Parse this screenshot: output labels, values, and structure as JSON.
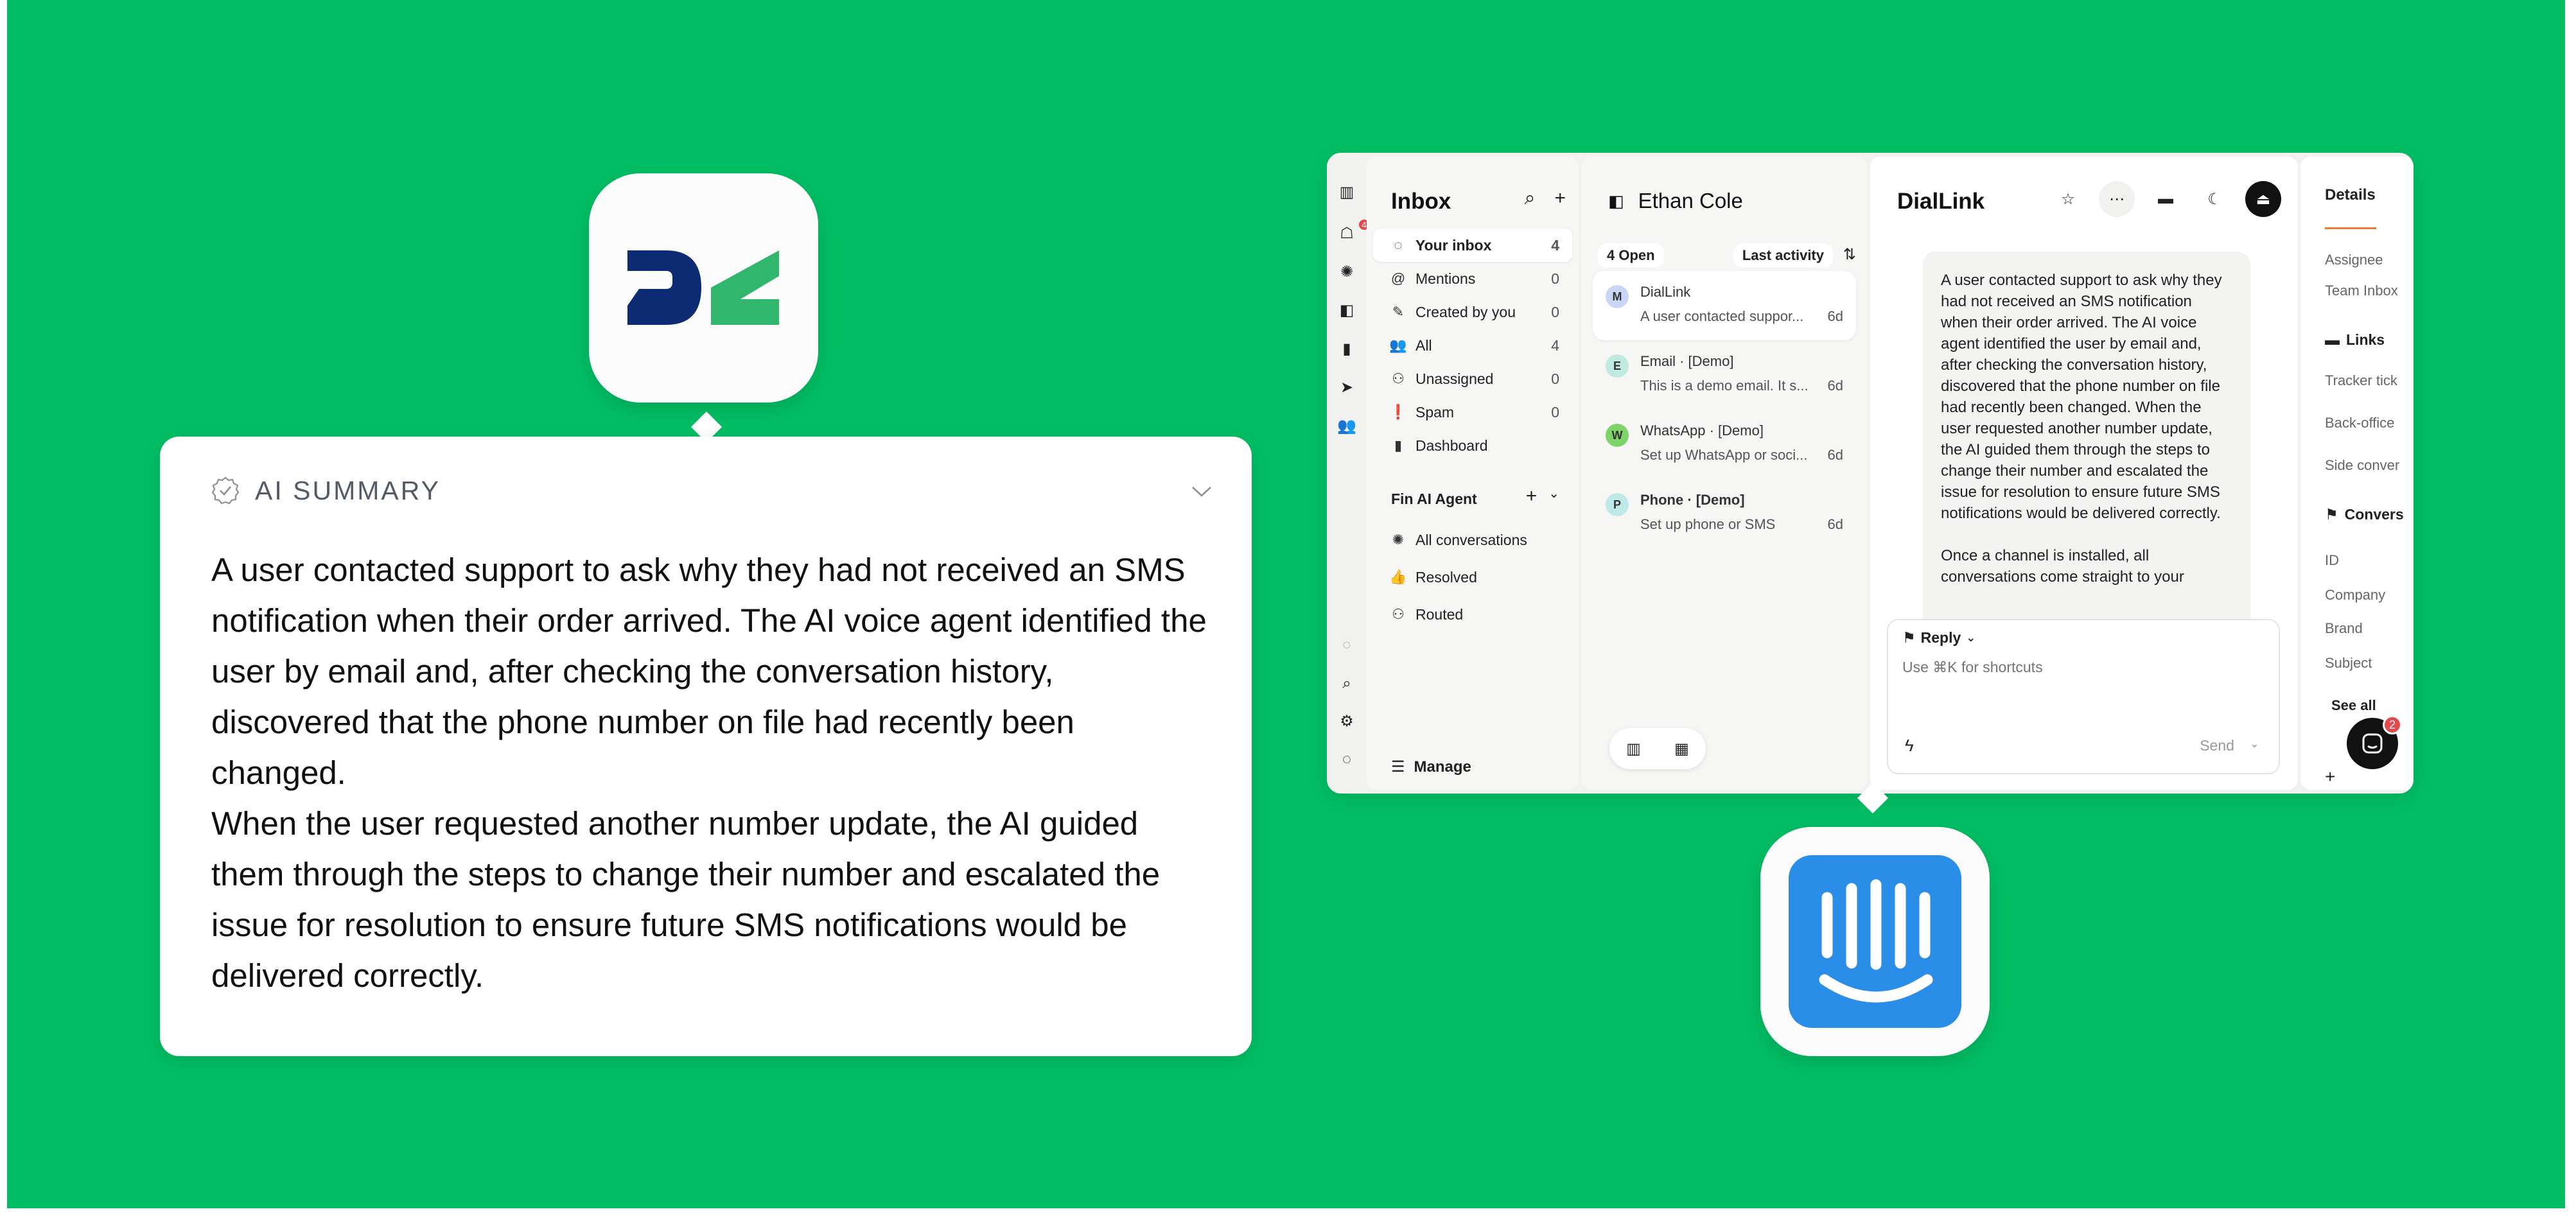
{
  "colors": {
    "background": "#02bd63",
    "intercom_blue": "#2a8de7",
    "dl_navy": "#0c2b73",
    "dl_green": "#31b66e"
  },
  "summary": {
    "icon": "check-badge-icon",
    "title": "AI SUMMARY",
    "paragraph1": "A user contacted support to ask why they had not received an SMS notification when their order arrived. The AI voice agent identified the user by email and, after checking the conversation history, discovered that the phone number on file had recently been changed.",
    "paragraph2": "When the user requested another number update, the AI guided them through the steps to change their number and escalated the issue for resolution to ensure future SMS notifications would be delivered correctly."
  },
  "app": {
    "rail_badge": "4",
    "inbox": {
      "title": "Inbox",
      "items": [
        {
          "icon": "avatar-icon",
          "label": "Your inbox",
          "count": "4"
        },
        {
          "icon": "at-icon",
          "label": "Mentions",
          "count": "0"
        },
        {
          "icon": "pen-icon",
          "label": "Created by you",
          "count": "0"
        },
        {
          "icon": "people-icon",
          "label": "All",
          "count": "4"
        },
        {
          "icon": "unassigned-icon",
          "label": "Unassigned",
          "count": "0"
        },
        {
          "icon": "spam-icon",
          "label": "Spam",
          "count": "0"
        },
        {
          "icon": "dashboard-icon",
          "label": "Dashboard",
          "count": ""
        }
      ],
      "fin_title": "Fin AI Agent",
      "fin_items": [
        {
          "icon": "fin-icon",
          "label": "All conversations"
        },
        {
          "icon": "thumbs-up-icon",
          "label": "Resolved"
        },
        {
          "icon": "routed-icon",
          "label": "Routed"
        }
      ],
      "manage": "Manage"
    },
    "list": {
      "title": "Ethan Cole",
      "open": "4 Open",
      "sort": "Last activity",
      "conversations": [
        {
          "initial": "M",
          "title": "DialLink",
          "preview": "A user contacted suppor...",
          "time": "6d",
          "avatar_color": "#c9d6f5"
        },
        {
          "initial": "E",
          "title": "Email · [Demo]",
          "preview": "This is a demo email. It s...",
          "time": "6d",
          "avatar_color": "#bfe9e1"
        },
        {
          "initial": "W",
          "title": "WhatsApp · [Demo]",
          "preview": "Set up WhatsApp or soci...",
          "time": "6d",
          "avatar_color": "#7fd36b"
        },
        {
          "initial": "P",
          "title": "Phone · [Demo]",
          "preview": "Set up phone or SMS",
          "time": "6d",
          "avatar_color": "#bfe9e8"
        }
      ]
    },
    "conversation": {
      "title": "DialLink",
      "message1": "A user contacted support to ask why they had not received an SMS notification when their order arrived. The AI voice agent identified the user by email and, after checking the conversation history, discovered that the phone number on file had recently been changed.  When the user requested another number update, the AI guided them through the steps to change their number and escalated the issue for resolution to ensure future SMS notifications would be delivered correctly.",
      "message2": "Once a channel is installed, all conversations come straight to your",
      "reply_label": "Reply",
      "composer_placeholder": "Use ⌘K for shortcuts",
      "send_label": "Send"
    },
    "details": {
      "tab": "Details",
      "assignee": "Assignee",
      "team_inbox": "Team Inbox",
      "links": "Links",
      "tracker": "Tracker tick",
      "backoffice": "Back-office",
      "side": "Side conver",
      "conversation": "Convers",
      "id": "ID",
      "company": "Company",
      "brand": "Brand",
      "subject": "Subject",
      "see_all": "See all",
      "messenger_badge": "2"
    }
  }
}
